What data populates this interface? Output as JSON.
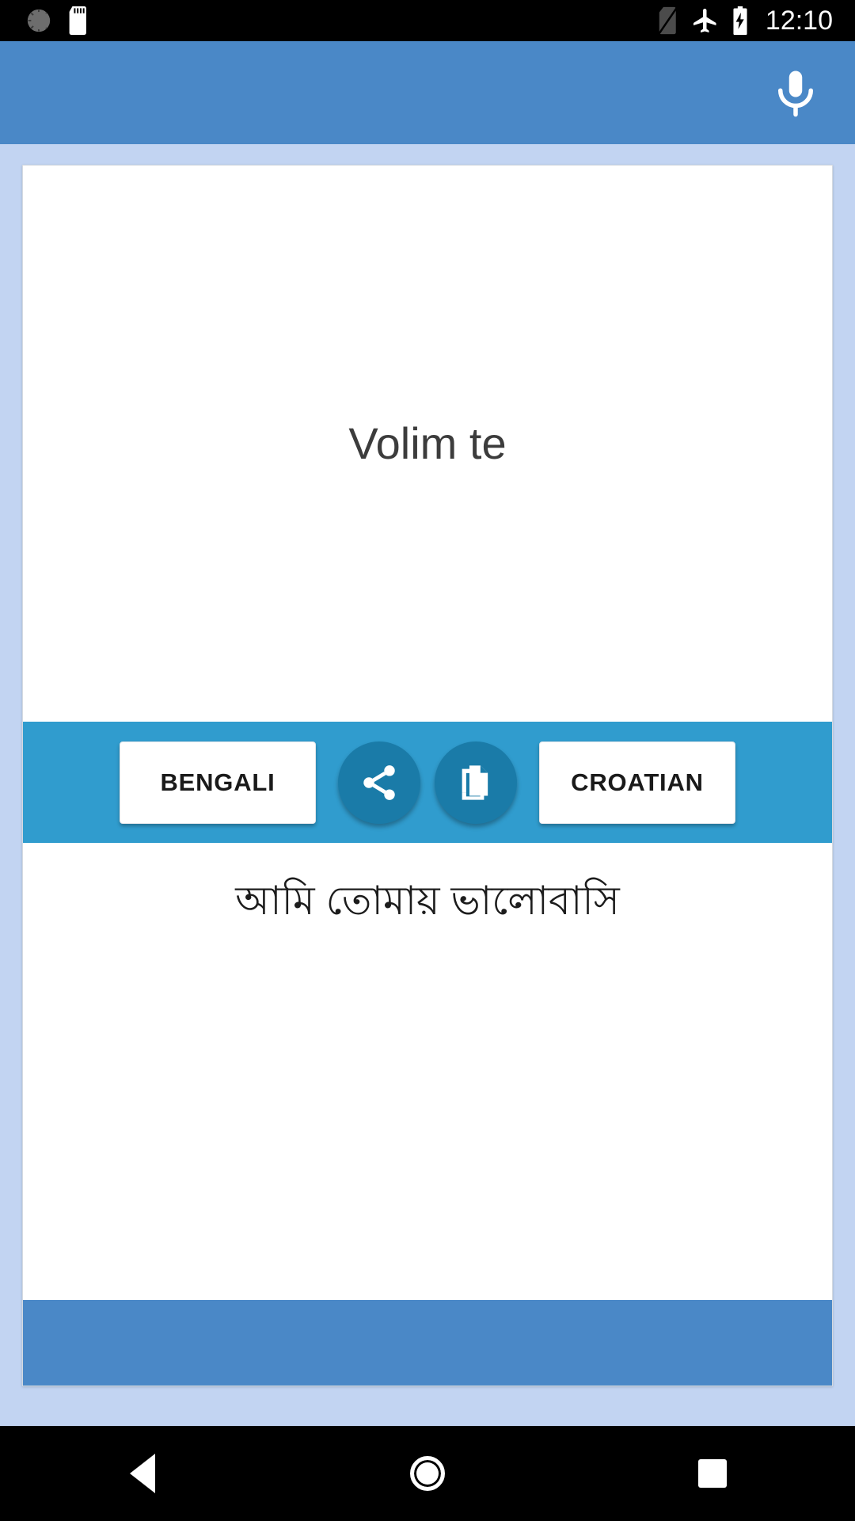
{
  "status_bar": {
    "icons_left": [
      "alarm-dim-icon",
      "sd-card-icon"
    ],
    "icons_right": [
      "no-sim-icon",
      "airplane-mode-icon",
      "battery-charging-icon"
    ],
    "clock": "12:10",
    "background": "#000000"
  },
  "app_bar": {
    "title": "",
    "mic_icon": "microphone-icon",
    "background": "#4a88c7"
  },
  "translator": {
    "source": {
      "text": "Volim te",
      "language_label": "CROATIAN"
    },
    "target": {
      "text": "আমি তোমায় ভালোবাসি",
      "language_label": "BENGALI"
    },
    "actions": {
      "share_icon": "share-icon",
      "copy_icon": "copy-icon",
      "bar_background": "#309cce",
      "fab_background": "#1a7ba8"
    }
  },
  "banner": {
    "background": "#4a88c7"
  },
  "nav_bar": {
    "back": "back-icon",
    "home": "home-icon",
    "recents": "recents-icon"
  },
  "theme": {
    "page_background": "#c2d4f2",
    "card_background": "#ffffff",
    "accent": "#4a88c7",
    "accent_dark": "#1a7ba8",
    "accent_light": "#309cce"
  }
}
